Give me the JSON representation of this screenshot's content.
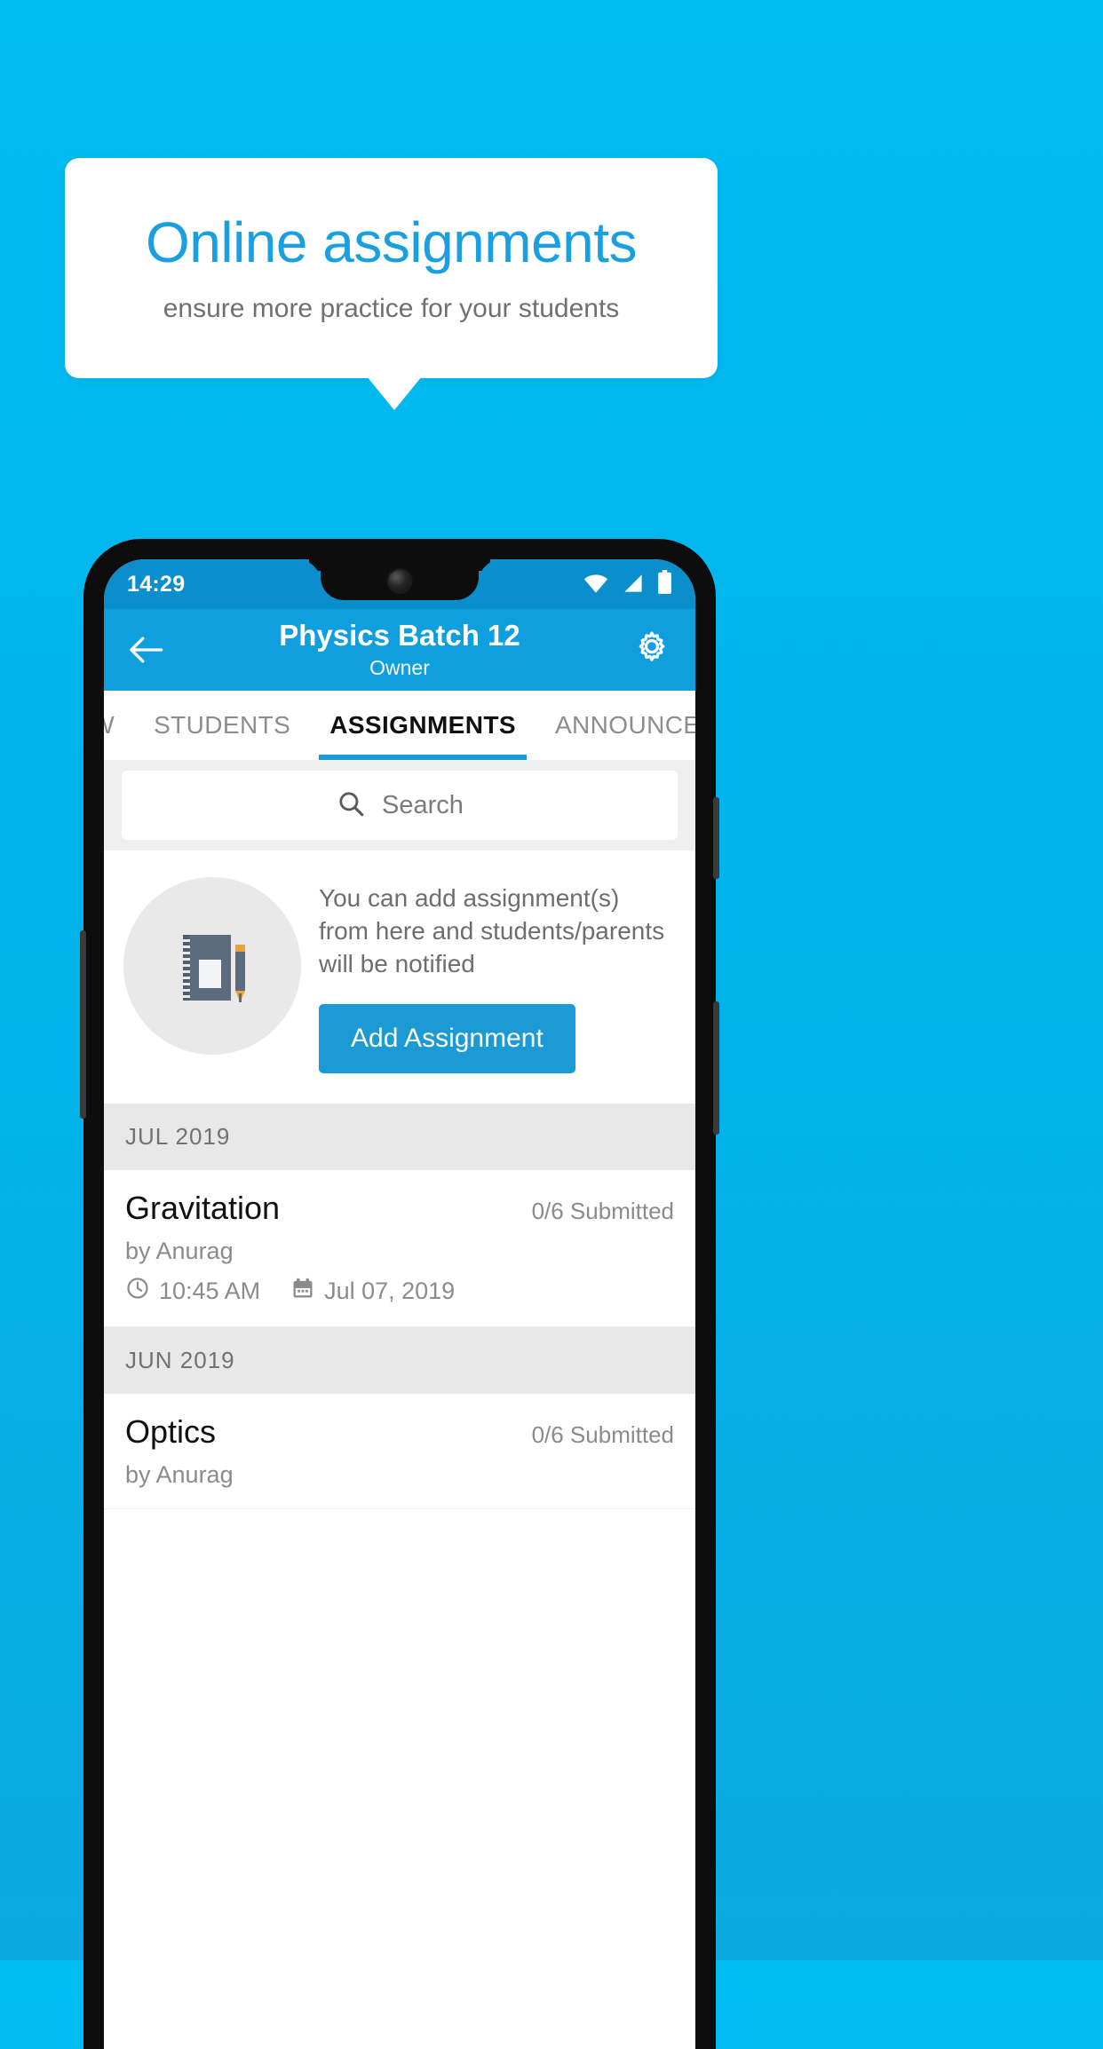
{
  "promo": {
    "title": "Online assignments",
    "subtitle": "ensure more practice for your students",
    "title_color": "#1a9fe0",
    "subtitle_color": "#6f7072",
    "background_color": "#00b5ec"
  },
  "phone": {
    "statusbar": {
      "time": "14:29",
      "icons": [
        "wifi-icon",
        "signal-icon",
        "battery-icon"
      ],
      "background_color": "#0b8fcc"
    },
    "appbar": {
      "back_icon": "arrow-left-icon",
      "title": "Physics Batch 12",
      "subtitle": "Owner",
      "settings_icon": "gear-icon",
      "background_color": "#0f9ede"
    },
    "tabs": {
      "items": [
        {
          "label": "IEW",
          "active": false
        },
        {
          "label": "STUDENTS",
          "active": false
        },
        {
          "label": "ASSIGNMENTS",
          "active": true
        },
        {
          "label": "ANNOUNCEMENTS",
          "active": false
        }
      ],
      "indicator_color": "#1b9ad6"
    },
    "search": {
      "icon": "search-icon",
      "placeholder": "Search",
      "value": ""
    },
    "empty_state": {
      "illustration": "notebook-pen-icon",
      "message": "You can add assignment(s) from here and students/parents will be notified",
      "button_label": "Add Assignment",
      "button_color": "#1b9ad6"
    },
    "assignment_groups": [
      {
        "month": "JUL 2019",
        "items": [
          {
            "title": "Gravitation",
            "submitted": "0/6 Submitted",
            "author": "by Anurag",
            "time_icon": "clock-icon",
            "time": "10:45 AM",
            "date_icon": "calendar-icon",
            "date": "Jul 07, 2019"
          }
        ]
      },
      {
        "month": "JUN 2019",
        "items": [
          {
            "title": "Optics",
            "submitted": "0/6 Submitted",
            "author": "by Anurag",
            "time_icon": "clock-icon",
            "time": "",
            "date_icon": "calendar-icon",
            "date": ""
          }
        ]
      }
    ]
  }
}
